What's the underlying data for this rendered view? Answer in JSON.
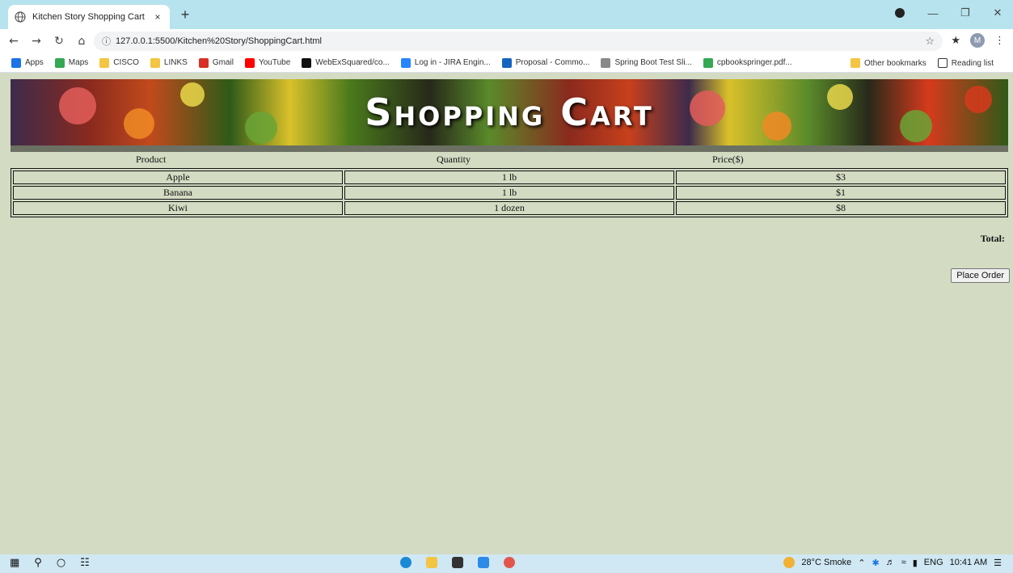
{
  "browser": {
    "tab_title": "Kitchen Story Shopping Cart",
    "tab_close": "×",
    "new_tab": "+",
    "url": "127.0.0.1:5500/Kitchen%20Story/ShoppingCart.html",
    "profile_initial": "M",
    "bookmarks": [
      {
        "label": "Apps",
        "color": "#1a73e8"
      },
      {
        "label": "Maps",
        "color": "#34a853"
      },
      {
        "label": "CISCO",
        "color": "#f4c542"
      },
      {
        "label": "LINKS",
        "color": "#f4c542"
      },
      {
        "label": "Gmail",
        "color": "#d93025"
      },
      {
        "label": "YouTube",
        "color": "#ff0000"
      },
      {
        "label": "WebExSquared/co...",
        "color": "#111111"
      },
      {
        "label": "Log in - JIRA Engin...",
        "color": "#2684ff"
      },
      {
        "label": "Proposal - Commo...",
        "color": "#1565c0"
      },
      {
        "label": "Spring Boot Test Sli...",
        "color": "#888888"
      },
      {
        "label": "cpbookspringer.pdf...",
        "color": "#34a853"
      }
    ],
    "other_bookmarks": "Other bookmarks",
    "reading_list": "Reading list"
  },
  "page": {
    "banner_title": "Shopping Cart",
    "columns": [
      "Product",
      "Quantity",
      "Price($)"
    ],
    "rows": [
      {
        "product": "Apple",
        "quantity": "1 lb",
        "price": "$3"
      },
      {
        "product": "Banana",
        "quantity": "1 lb",
        "price": "$1"
      },
      {
        "product": "Kiwi",
        "quantity": "1 dozen",
        "price": "$8"
      }
    ],
    "total_label": "Total:",
    "place_order": "Place Order"
  },
  "taskbar": {
    "weather": "28°C Smoke",
    "language": "ENG",
    "time": "10:41 AM"
  }
}
